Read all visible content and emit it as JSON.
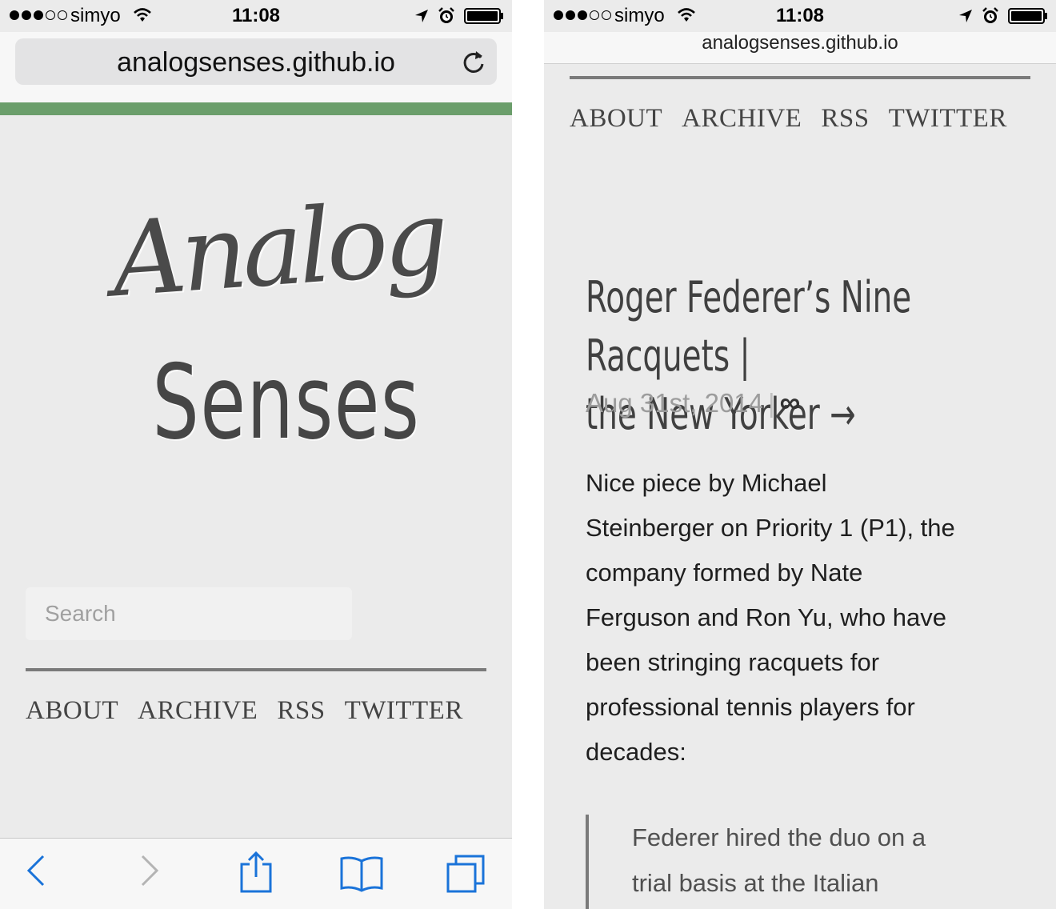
{
  "left": {
    "status": {
      "carrier": "simyo",
      "time": "11:08",
      "signal_bars": 3,
      "signal_total": 5
    },
    "url": "analogsenses.github.io",
    "logo": {
      "line1": "Analog",
      "line2": "Senses"
    },
    "search": {
      "placeholder": "Search"
    },
    "nav": [
      "ABOUT",
      "ARCHIVE",
      "RSS",
      "TWITTER"
    ],
    "accent_color": "#6b9e6b",
    "toolbar": [
      "back-icon",
      "forward-icon",
      "share-icon",
      "bookmarks-icon",
      "tabs-icon"
    ]
  },
  "right": {
    "status": {
      "carrier": "simyo",
      "time": "11:08"
    },
    "url": "analogsenses.github.io",
    "nav": [
      "ABOUT",
      "ARCHIVE",
      "RSS",
      "TWITTER"
    ],
    "post": {
      "title_line1": "Roger Federer’s Nine Racquets |",
      "title_line2": "the New Yorker →",
      "date": "Aug 31st, 2014",
      "separator": "|",
      "permalink": "∞",
      "body_lines": [
        "Nice piece by Michael",
        "Steinberger on Priority 1 (P1), the",
        "company formed by Nate",
        "Ferguson and Ron Yu, who have",
        "been stringing racquets for",
        "professional tennis players for",
        "decades:"
      ],
      "quote_lines": [
        "Federer hired the duo on a",
        "trial basis at the Italian"
      ]
    }
  }
}
